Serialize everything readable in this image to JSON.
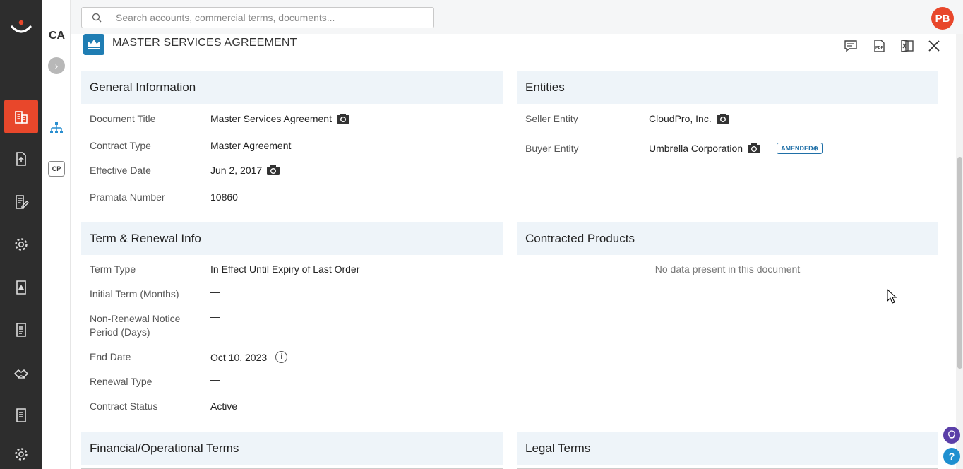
{
  "app": {
    "logo": "smile-logo"
  },
  "topbar": {
    "search_placeholder": "Search accounts, commercial terms, documents...",
    "avatar_initials": "PB"
  },
  "rail": {
    "title": "CA",
    "cp_label": "CP"
  },
  "document": {
    "title": "MASTER SERVICES AGREEMENT",
    "actions": [
      "comment-icon",
      "pdf-icon",
      "excel-icon",
      "close-icon"
    ]
  },
  "general": {
    "heading": "General Information",
    "rows": [
      {
        "label": "Document Title",
        "value": "Master Services Agreement"
      },
      {
        "label": "Contract Type",
        "value": "Master Agreement"
      },
      {
        "label": "Effective Date",
        "value": "Jun 2, 2017"
      },
      {
        "label": "Pramata Number",
        "value": "10860"
      }
    ]
  },
  "entities": {
    "heading": "Entities",
    "rows": [
      {
        "label": "Seller Entity",
        "value": "CloudPro, Inc."
      },
      {
        "label": "Buyer Entity",
        "value": "Umbrella Corporation",
        "badge": "AMENDED"
      }
    ]
  },
  "term": {
    "heading": "Term & Renewal Info",
    "rows": [
      {
        "label": "Term Type",
        "value": "In Effect Until Expiry of Last Order"
      },
      {
        "label": "Initial Term (Months)",
        "value": "—"
      },
      {
        "label": "Non-Renewal Notice Period (Days)",
        "value": "—"
      },
      {
        "label": "End Date",
        "value": "Oct 10, 2023"
      },
      {
        "label": "Renewal Type",
        "value": "—"
      },
      {
        "label": "Contract Status",
        "value": "Active"
      }
    ]
  },
  "products": {
    "heading": "Contracted Products",
    "empty": "No data present in this document"
  },
  "financial": {
    "heading": "Financial/Operational Terms"
  },
  "legal": {
    "heading": "Legal Terms"
  },
  "colors": {
    "accent": "#e8472b",
    "brand_blue": "#1f7db3",
    "section_bg": "#eef4f9",
    "nav_bg": "#2d2d2d"
  }
}
